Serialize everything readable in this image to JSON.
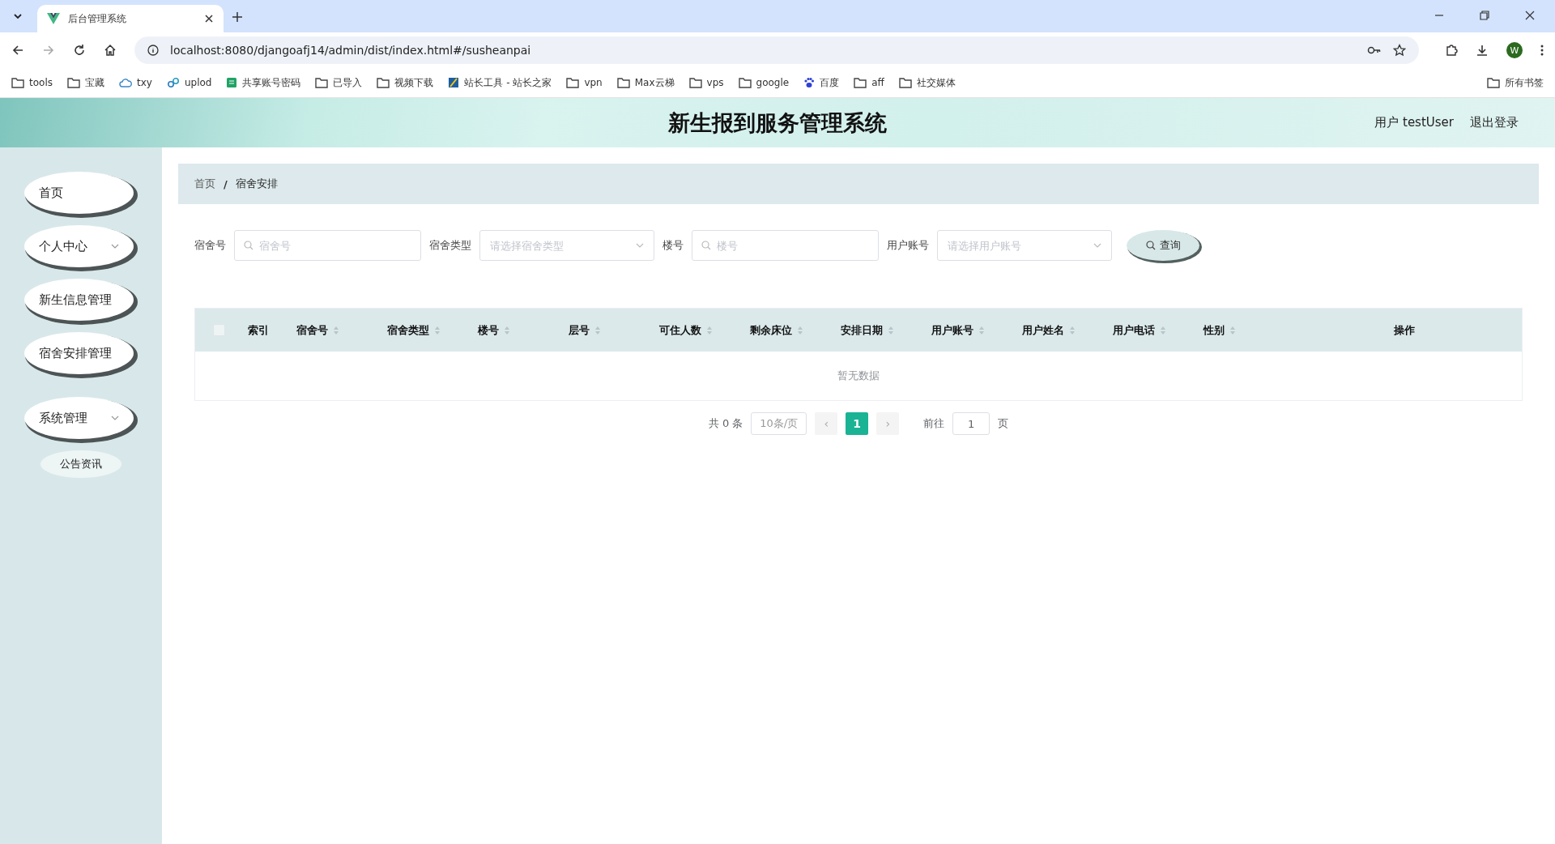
{
  "browser": {
    "tabs": [
      {
        "title": "后台管理系统",
        "selected": true
      }
    ],
    "url": "localhost:8080/djangoafj14/admin/dist/index.html#/susheanpai",
    "profile": "W",
    "bookmarks": [
      {
        "label": "tools",
        "kind": "folder"
      },
      {
        "label": "宝藏",
        "kind": "folder"
      },
      {
        "label": "txy",
        "kind": "cloud"
      },
      {
        "label": "uplod",
        "kind": "link"
      },
      {
        "label": "共享账号密码",
        "kind": "sheet"
      },
      {
        "label": "已导入",
        "kind": "folder"
      },
      {
        "label": "视频下载",
        "kind": "folder"
      },
      {
        "label": "站长工具 - 站长之家",
        "kind": "app"
      },
      {
        "label": "vpn",
        "kind": "folder"
      },
      {
        "label": "Max云梯",
        "kind": "folder"
      },
      {
        "label": "vps",
        "kind": "folder"
      },
      {
        "label": "google",
        "kind": "folder"
      },
      {
        "label": "百度",
        "kind": "paw"
      },
      {
        "label": "aff",
        "kind": "folder"
      },
      {
        "label": "社交媒体",
        "kind": "folder"
      }
    ],
    "all_bookmarks": "所有书签"
  },
  "header": {
    "title": "新生报到服务管理系统",
    "user": "用户 testUser",
    "logout": "退出登录"
  },
  "sidebar": {
    "items": [
      {
        "label": "首页",
        "kind": "item"
      },
      {
        "label": "个人中心",
        "kind": "submenu"
      },
      {
        "label": "新生信息管理",
        "kind": "item"
      },
      {
        "label": "宿舍安排管理",
        "kind": "item"
      },
      {
        "label": "系统管理",
        "kind": "submenu",
        "children": [
          {
            "label": "公告资讯"
          }
        ]
      }
    ]
  },
  "breadcrumb": [
    "首页",
    "宿舍安排"
  ],
  "breadcrumb_separator": "/",
  "filters": [
    {
      "label": "宿舍号",
      "kind": "input",
      "placeholder": "宿舍号"
    },
    {
      "label": "宿舍类型",
      "kind": "select",
      "placeholder": "请选择宿舍类型"
    },
    {
      "label": "楼号",
      "kind": "input",
      "placeholder": "楼号"
    },
    {
      "label": "用户账号",
      "kind": "select",
      "placeholder": "请选择用户账号"
    }
  ],
  "search_button": "查询",
  "table": {
    "select_all": {
      "checked": false
    },
    "columns": [
      {
        "label": "索引",
        "sortable": false
      },
      {
        "label": "宿舍号",
        "sortable": true
      },
      {
        "label": "宿舍类型",
        "sortable": true
      },
      {
        "label": "楼号",
        "sortable": true
      },
      {
        "label": "层号",
        "sortable": true
      },
      {
        "label": "可住人数",
        "sortable": true
      },
      {
        "label": "剩余床位",
        "sortable": true
      },
      {
        "label": "安排日期",
        "sortable": true
      },
      {
        "label": "用户账号",
        "sortable": true
      },
      {
        "label": "用户姓名",
        "sortable": true
      },
      {
        "label": "用户电话",
        "sortable": true
      },
      {
        "label": "性别",
        "sortable": true
      },
      {
        "label": "操作",
        "sortable": false
      }
    ],
    "empty_text": "暂无数据"
  },
  "pagination": {
    "total": "共 0 条",
    "page_size": "10条/页",
    "prev": "‹",
    "pages": [
      {
        "label": "1",
        "selected": true
      }
    ],
    "next": "›",
    "goto_label": "前往",
    "goto_value": "1",
    "page_suffix": "页"
  }
}
